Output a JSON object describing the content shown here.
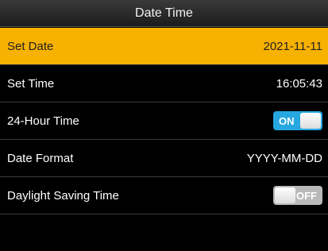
{
  "title": "Date Time",
  "rows": [
    {
      "label": "Set Date",
      "value": "2021-11-11"
    },
    {
      "label": "Set Time",
      "value": "16:05:43"
    },
    {
      "label": "24-Hour Time",
      "toggle": "ON"
    },
    {
      "label": "Date Format",
      "value": "YYYY-MM-DD"
    },
    {
      "label": "Daylight Saving Time",
      "toggle": "OFF"
    }
  ],
  "colors": {
    "selected_row": "#f7b100",
    "toggle_on": "#27a7e0",
    "toggle_off": "#b9b9b9"
  }
}
